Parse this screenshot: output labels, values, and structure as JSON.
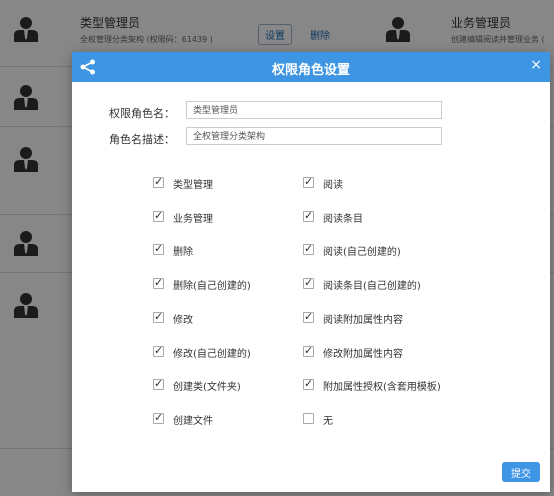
{
  "background": {
    "items": [
      {
        "title": "类型管理员",
        "subtitle": "全权管理分类架构 (权限码：61439 )",
        "button": "设置",
        "link": "删除"
      },
      {
        "title": "业务管理员",
        "subtitle": "创建编辑阅读并管理业务 ("
      }
    ]
  },
  "dialog": {
    "title": "权限角色设置",
    "close": "×",
    "name_label": "权限角色名：",
    "name_value": "类型管理员",
    "desc_label": "角色名描述：",
    "desc_value": "全权管理分类架构",
    "submit": "提交",
    "permissions_left": [
      {
        "label": "类型管理",
        "checked": true
      },
      {
        "label": "业务管理",
        "checked": true
      },
      {
        "label": "删除",
        "checked": true
      },
      {
        "label": "删除(自己创建的)",
        "checked": true
      },
      {
        "label": "修改",
        "checked": true
      },
      {
        "label": "修改(自己创建的)",
        "checked": true
      },
      {
        "label": "创建类(文件夹)",
        "checked": true
      },
      {
        "label": "创建文件",
        "checked": true
      }
    ],
    "permissions_right": [
      {
        "label": "阅读",
        "checked": true
      },
      {
        "label": "阅读条目",
        "checked": true
      },
      {
        "label": "阅读(自己创建的)",
        "checked": true
      },
      {
        "label": "阅读条目(自己创建的)",
        "checked": true
      },
      {
        "label": "阅读附加属性内容",
        "checked": true
      },
      {
        "label": "修改附加属性内容",
        "checked": true
      },
      {
        "label": "附加属性授权(含套用模板)",
        "checked": true
      },
      {
        "label": "无",
        "checked": false
      }
    ]
  },
  "colors": {
    "accent": "#3d95e3",
    "link": "#1e6fb8"
  }
}
